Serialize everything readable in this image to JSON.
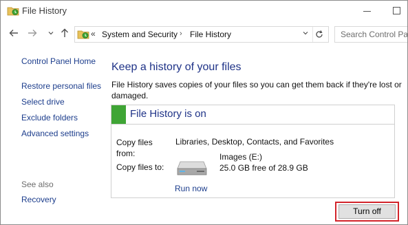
{
  "window": {
    "title": "File History",
    "app_icon": "file-history-icon"
  },
  "navigation": {
    "back_icon": "arrow-left-icon",
    "forward_icon": "arrow-right-icon",
    "recent_icon": "chevron-down-icon",
    "up_icon": "arrow-up-icon",
    "address": {
      "overflow_chevron": "«",
      "breadcrumbs": [
        "System and Security",
        "File History"
      ],
      "separator": "›"
    },
    "refresh_icon": "refresh-icon",
    "search": {
      "placeholder": "Search Control Panel"
    }
  },
  "sidebar": {
    "home_link": "Control Panel Home",
    "links": [
      "Restore personal files",
      "Select drive",
      "Exclude folders",
      "Advanced settings"
    ],
    "see_also_label": "See also",
    "see_also_links": [
      "Recovery"
    ]
  },
  "main": {
    "heading": "Keep a history of your files",
    "description": "File History saves copies of your files so you can get them back if they're lost or damaged.",
    "status": {
      "title": "File History is on",
      "indicator_color": "#3fa535",
      "copy_from_label": "Copy files from:",
      "copy_from_value": "Libraries, Desktop, Contacts, and Favorites",
      "copy_to_label": "Copy files to:",
      "drive_name": "Images (E:)",
      "drive_space": "25.0 GB free of 28.9 GB",
      "run_now_label": "Run now"
    },
    "turn_off_label": "Turn off",
    "highlight_color": "#d2232a"
  }
}
